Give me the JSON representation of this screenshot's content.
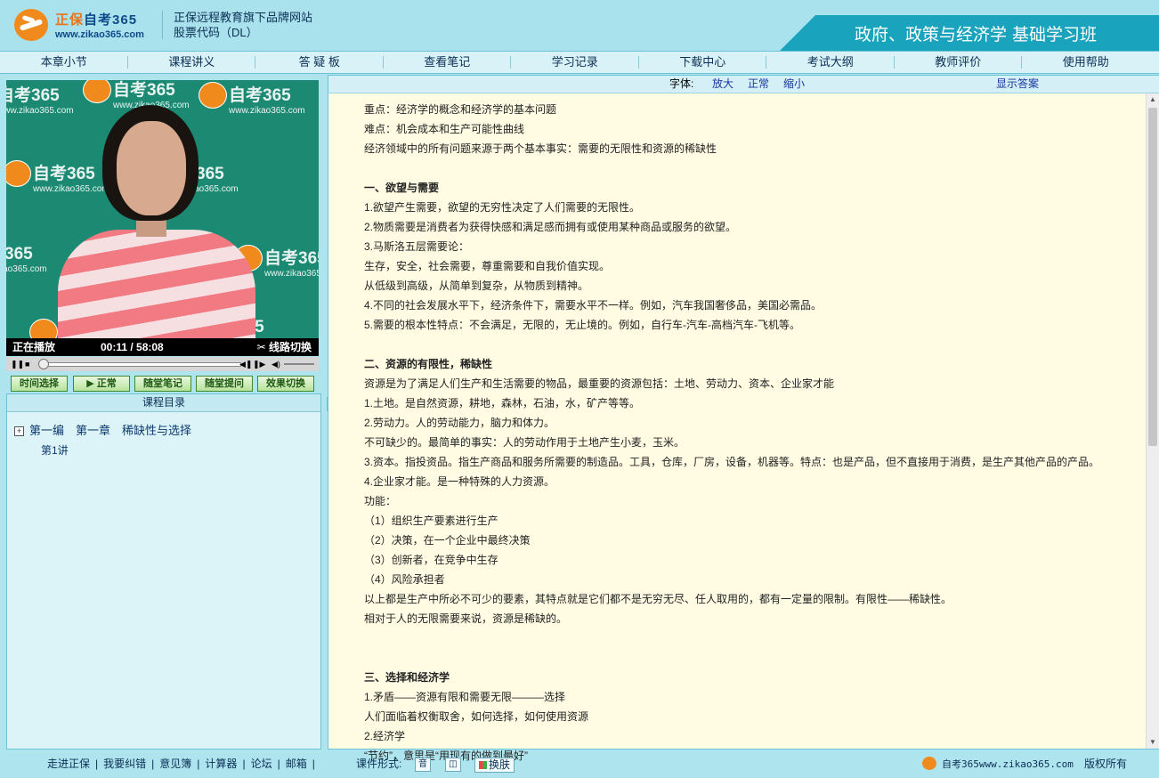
{
  "header": {
    "logo_cn": "正保",
    "logo_cn2": "自考365",
    "logo_url": "www.zikao365.com",
    "tagline1": "正保远程教育旗下品牌网站",
    "tagline2": "股票代码（DL）",
    "course_title": "政府、政策与经济学 基础学习班"
  },
  "nav": [
    "本章小节",
    "课程讲义",
    "答 疑 板",
    "查看笔记",
    "学习记录",
    "下载中心",
    "考试大纲",
    "教师评价",
    "使用帮助"
  ],
  "video": {
    "watermark": "自考365",
    "watermark_url": "www.zikao365.com",
    "status": "正在播放",
    "time": "00:11 / 58:08",
    "switch_label": "线路切换",
    "progress_fraction": 0.0032
  },
  "controls": [
    "时间选择",
    "▶ 正常",
    "随堂笔记",
    "随堂提问",
    "效果切换"
  ],
  "catalog": {
    "title": "课程目录",
    "chapter_plus": "+",
    "chapter": "第一编　第一章　稀缺性与选择",
    "lecture": "第1讲"
  },
  "toolbar": {
    "font_label": "字体:",
    "enlarge": "放大",
    "normal": "正常",
    "shrink": "缩小",
    "show_answer": "显示答案"
  },
  "lecture_lines": [
    {
      "t": "重点：经济学的概念和经济学的基本问题",
      "b": false
    },
    {
      "t": "难点：机会成本和生产可能性曲线",
      "b": false
    },
    {
      "t": "经济领域中的所有问题来源于两个基本事实：需要的无限性和资源的稀缺性",
      "b": false
    },
    {
      "t": "",
      "b": false
    },
    {
      "t": "一、欲望与需要",
      "b": true
    },
    {
      "t": "1.欲望产生需要，欲望的无穷性决定了人们需要的无限性。",
      "b": false
    },
    {
      "t": "2.物质需要是消费者为获得快感和满足感而拥有或使用某种商品或服务的欲望。",
      "b": false
    },
    {
      "t": "3.马斯洛五层需要论：",
      "b": false
    },
    {
      "t": "生存，安全，社会需要，尊重需要和自我价值实现。",
      "b": false
    },
    {
      "t": "从低级到高级，从简单到复杂，从物质到精神。",
      "b": false
    },
    {
      "t": "4.不同的社会发展水平下，经济条件下，需要水平不一样。例如，汽车我国奢侈品，美国必需品。",
      "b": false
    },
    {
      "t": "5.需要的根本性特点：不会满足，无限的，无止境的。例如，自行车-汽车-高档汽车-飞机等。",
      "b": false
    },
    {
      "t": "",
      "b": false
    },
    {
      "t": "二、资源的有限性，稀缺性",
      "b": true
    },
    {
      "t": "资源是为了满足人们生产和生活需要的物品，最重要的资源包括：土地、劳动力、资本、企业家才能",
      "b": false
    },
    {
      "t": "1.土地。是自然资源，耕地，森林，石油，水，矿产等等。",
      "b": false
    },
    {
      "t": "2.劳动力。人的劳动能力，脑力和体力。",
      "b": false
    },
    {
      "t": "不可缺少的。最简单的事实：人的劳动作用于土地产生小麦，玉米。",
      "b": false
    },
    {
      "t": "3.资本。指投资品。指生产商品和服务所需要的制造品。工具，仓库，厂房，设备，机器等。特点：也是产品，但不直接用于消费，是生产其他产品的产品。",
      "b": false
    },
    {
      "t": "4.企业家才能。是一种特殊的人力资源。",
      "b": false
    },
    {
      "t": "功能：",
      "b": false
    },
    {
      "t": "（1）组织生产要素进行生产",
      "b": false
    },
    {
      "t": "（2）决策，在一个企业中最终决策",
      "b": false
    },
    {
      "t": "（3）创新者，在竞争中生存",
      "b": false
    },
    {
      "t": "（4）风险承担者",
      "b": false
    },
    {
      "t": "以上都是生产中所必不可少的要素，其特点就是它们都不是无穷无尽、任人取用的，都有一定量的限制。有限性——稀缺性。",
      "b": false
    },
    {
      "t": "相对于人的无限需要来说，资源是稀缺的。",
      "b": false
    },
    {
      "t": "",
      "b": false
    },
    {
      "t": "",
      "b": false
    },
    {
      "t": "三、选择和经济学",
      "b": true
    },
    {
      "t": "1.矛盾——资源有限和需要无限———选择",
      "b": false
    },
    {
      "t": "人们面临着权衡取舍，如何选择，如何使用资源",
      "b": false
    },
    {
      "t": "2.经济学",
      "b": false
    },
    {
      "t": "“节约”，意思是“用现有的做到最好”",
      "b": false
    }
  ],
  "footer": {
    "links": [
      "走进正保",
      "我要纠错",
      "意见簿",
      "计算器",
      "论坛",
      "邮箱"
    ],
    "format_label": "课件形式:",
    "format_icon1": "音",
    "skin": "换肤",
    "brand": "自考365www.zikao365.com",
    "rights": "版权所有"
  },
  "colors": {
    "accent": "#1aa3bd",
    "link": "#1636a0",
    "content_bg": "#fffce3",
    "page_bg": "#aee4ee"
  }
}
